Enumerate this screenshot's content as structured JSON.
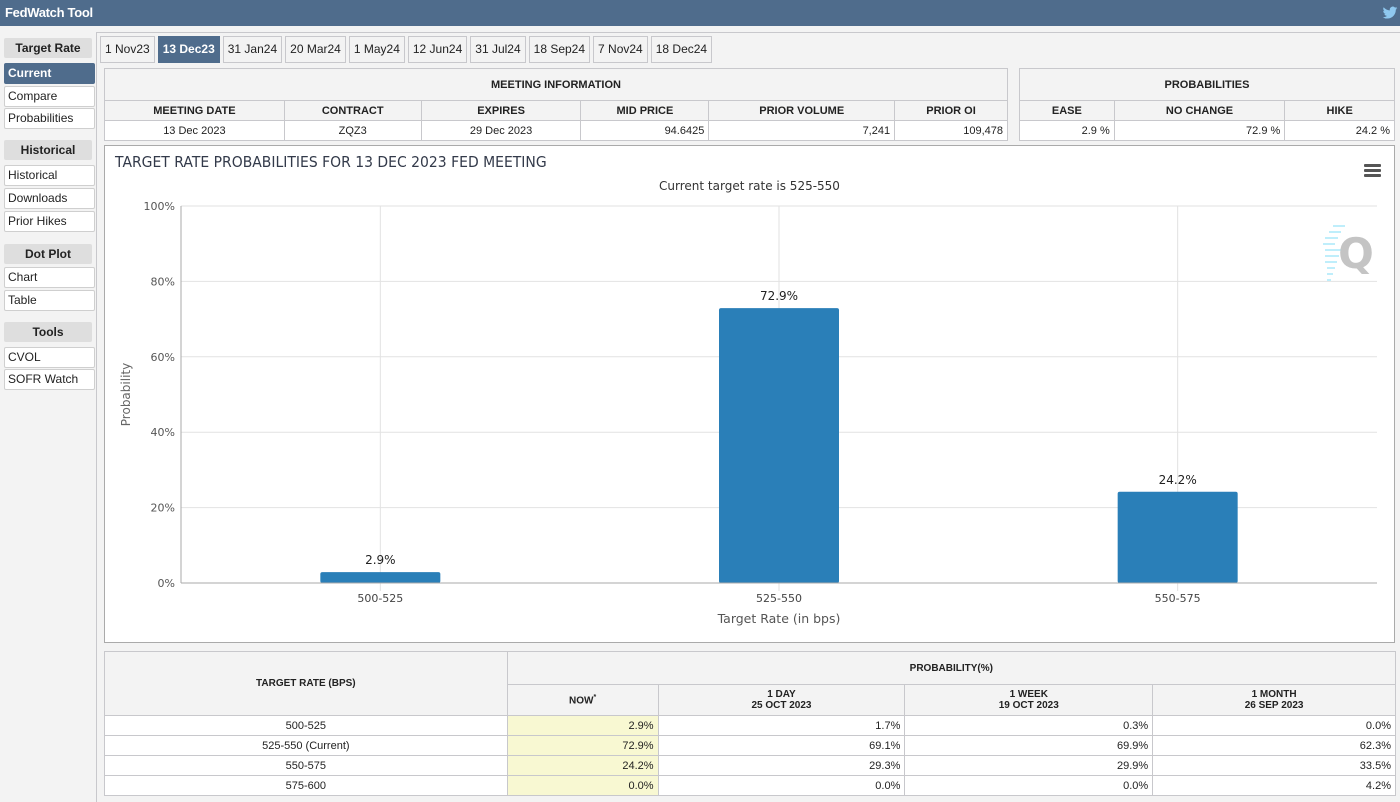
{
  "app": {
    "title": "FedWatch Tool",
    "share_icon": "twitter-icon"
  },
  "sidebar": {
    "sections": [
      {
        "heading": "Target Rate",
        "items": [
          {
            "label": "Current",
            "active": true
          },
          {
            "label": "Compare"
          },
          {
            "label": "Probabilities"
          }
        ]
      },
      {
        "heading": "Historical",
        "items": [
          {
            "label": "Historical"
          },
          {
            "label": "Downloads"
          },
          {
            "label": "Prior Hikes"
          }
        ]
      },
      {
        "heading": "Dot Plot",
        "items": [
          {
            "label": "Chart"
          },
          {
            "label": "Table"
          }
        ]
      },
      {
        "heading": "Tools",
        "items": [
          {
            "label": "CVOL"
          },
          {
            "label": "SOFR Watch"
          }
        ]
      }
    ]
  },
  "tabs": [
    {
      "label": "1 Nov23"
    },
    {
      "label": "13 Dec23",
      "active": true
    },
    {
      "label": "31 Jan24"
    },
    {
      "label": "20 Mar24"
    },
    {
      "label": "1 May24"
    },
    {
      "label": "12 Jun24"
    },
    {
      "label": "31 Jul24"
    },
    {
      "label": "18 Sep24"
    },
    {
      "label": "7 Nov24"
    },
    {
      "label": "18 Dec24"
    }
  ],
  "meeting_info": {
    "group_header": "MEETING INFORMATION",
    "headers": [
      "MEETING DATE",
      "CONTRACT",
      "EXPIRES",
      "MID PRICE",
      "PRIOR VOLUME",
      "PRIOR OI"
    ],
    "values": [
      "13 Dec 2023",
      "ZQZ3",
      "29 Dec 2023",
      "94.6425",
      "7,241",
      "109,478"
    ]
  },
  "probabilities_summary": {
    "group_header": "PROBABILITIES",
    "headers": [
      "EASE",
      "NO CHANGE",
      "HIKE"
    ],
    "values": [
      "2.9 %",
      "72.9 %",
      "24.2 %"
    ]
  },
  "chart_menu_icon": "hamburger-menu-icon",
  "watermark": "Q",
  "chart_data": {
    "type": "bar",
    "title": "TARGET RATE PROBABILITIES FOR 13 DEC 2023 FED MEETING",
    "subtitle": "Current target rate is 525-550",
    "categories": [
      "500-525",
      "525-550",
      "550-575"
    ],
    "values": [
      2.9,
      72.9,
      24.2
    ],
    "data_labels": [
      "2.9%",
      "72.9%",
      "24.2%"
    ],
    "xlabel": "Target Rate (in bps)",
    "ylabel": "Probability",
    "ylim": [
      0,
      100
    ],
    "yticks": [
      0,
      20,
      40,
      60,
      80,
      100
    ],
    "ytick_labels": [
      "0%",
      "20%",
      "40%",
      "60%",
      "80%",
      "100%"
    ],
    "grid": true,
    "bar_color": "#2a7fb8"
  },
  "prob_table": {
    "rate_header": "TARGET RATE (BPS)",
    "group_header": "PROBABILITY(%)",
    "columns": [
      {
        "label": "NOW",
        "marker": "*",
        "date": ""
      },
      {
        "label": "1 DAY",
        "date": "25 OCT 2023"
      },
      {
        "label": "1 WEEK",
        "date": "19 OCT 2023"
      },
      {
        "label": "1 MONTH",
        "date": "26 SEP 2023"
      }
    ],
    "rows": [
      {
        "rate": "500-525",
        "values": [
          "2.9%",
          "1.7%",
          "0.3%",
          "0.0%"
        ]
      },
      {
        "rate": "525-550 (Current)",
        "values": [
          "72.9%",
          "69.1%",
          "69.9%",
          "62.3%"
        ]
      },
      {
        "rate": "550-575",
        "values": [
          "24.2%",
          "29.3%",
          "29.9%",
          "33.5%"
        ]
      },
      {
        "rate": "575-600",
        "values": [
          "0.0%",
          "0.0%",
          "0.0%",
          "4.2%"
        ]
      }
    ]
  }
}
